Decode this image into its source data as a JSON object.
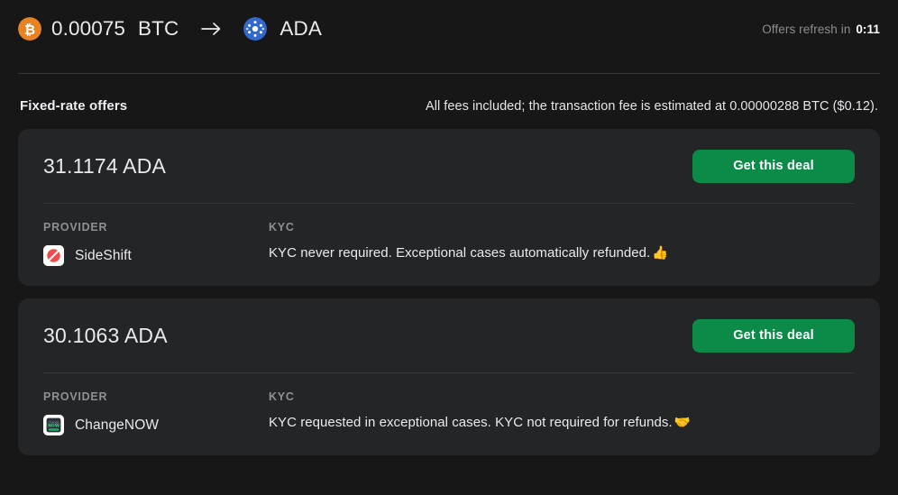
{
  "header": {
    "from": {
      "amount": "0.00075",
      "symbol": "BTC",
      "icon": "bitcoin-icon",
      "icon_color": "#e78322"
    },
    "to": {
      "symbol": "ADA",
      "icon": "cardano-icon",
      "icon_color": "#3468d1"
    },
    "arrow_icon": "arrow-right-icon",
    "refresh_label": "Offers refresh in",
    "refresh_time": "0:11"
  },
  "subhead": {
    "title": "Fixed-rate offers",
    "note": "All fees included; the transaction fee is estimated at 0.00000288 BTC ($0.12)."
  },
  "columns": {
    "provider": "PROVIDER",
    "kyc": "KYC"
  },
  "button_label": "Get this deal",
  "accent_green": "#0b8a48",
  "offers": [
    {
      "amount": "31.1174 ADA",
      "provider": "SideShift",
      "provider_icon": "sideshift-logo-icon",
      "kyc": "KYC never required. Exceptional cases automatically refunded.",
      "kyc_emoji": "👍",
      "button_label": "Get this deal"
    },
    {
      "amount": "30.1063 ADA",
      "provider": "ChangeNOW",
      "provider_icon": "changenow-logo-icon",
      "kyc": "KYC requested in exceptional cases. KYC not required for refunds.",
      "kyc_emoji": "🤝",
      "button_label": "Get this deal"
    }
  ]
}
